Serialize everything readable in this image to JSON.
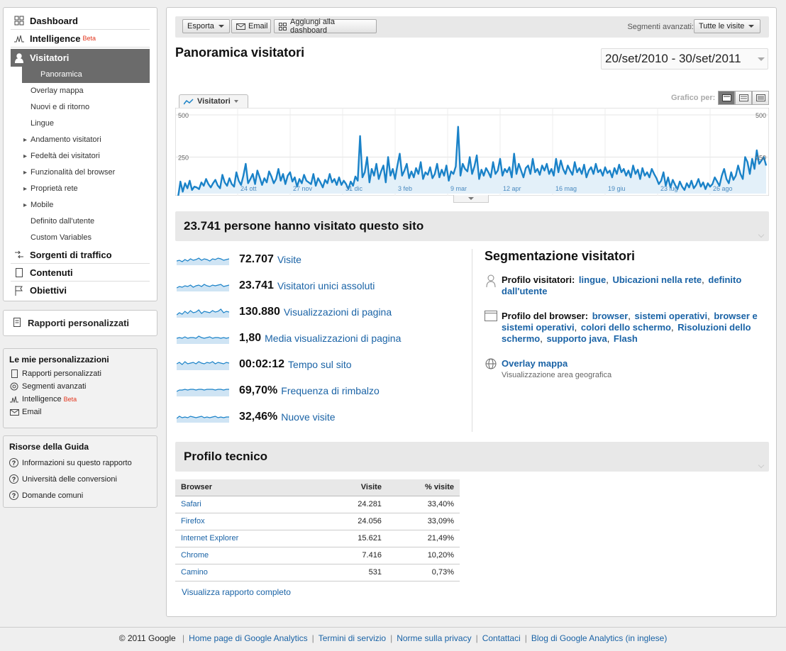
{
  "sidebar": {
    "nav": [
      {
        "label": "Dashboard",
        "icon": "dashboard-icon"
      },
      {
        "label": "Intelligence",
        "badge": "Beta",
        "icon": "intelligence-icon"
      },
      {
        "label": "Visitatori",
        "icon": "visitor-icon",
        "active": true
      },
      {
        "label": "Sorgenti di traffico",
        "icon": "traffic-sources-icon"
      },
      {
        "label": "Contenuti",
        "icon": "content-icon"
      },
      {
        "label": "Obiettivi",
        "icon": "flag-icon"
      }
    ],
    "visitor_subitems": [
      {
        "label": "Panoramica",
        "active": true,
        "arrow": false
      },
      {
        "label": "Overlay mappa",
        "arrow": false
      },
      {
        "label": "Nuovi e di ritorno",
        "arrow": false
      },
      {
        "label": "Lingue",
        "arrow": false
      },
      {
        "label": "Andamento visitatori",
        "arrow": true
      },
      {
        "label": "Fedeltà dei visitatori",
        "arrow": true
      },
      {
        "label": "Funzionalità del browser",
        "arrow": true
      },
      {
        "label": "Proprietà rete",
        "arrow": true
      },
      {
        "label": "Mobile",
        "arrow": true
      },
      {
        "label": "Definito dall'utente",
        "arrow": false
      },
      {
        "label": "Custom Variables",
        "arrow": false
      }
    ],
    "custom_reports": "Rapporti personalizzati",
    "personal": {
      "title": "Le mie personalizzazioni",
      "items": [
        {
          "label": "Rapporti personalizzati"
        },
        {
          "label": "Segmenti avanzati"
        },
        {
          "label": "Intelligence",
          "badge": "Beta"
        },
        {
          "label": "Email"
        }
      ]
    },
    "help": {
      "title": "Risorse della Guida",
      "items": [
        {
          "label": "Informazioni su questo rapporto"
        },
        {
          "label": "Università delle conversioni"
        },
        {
          "label": "Domande comuni"
        }
      ]
    }
  },
  "toolbar": {
    "export": "Esporta",
    "email": "Email",
    "add_dashboard": "Aggiungi alla dashboard",
    "segments_label": "Segmenti avanzati:",
    "segment_value": "Tutte le visite"
  },
  "page": {
    "title": "Panoramica visitatori",
    "date_range": "20/set/2010 - 30/set/2011",
    "chart_tab": "Visitatori",
    "chart_by": "Grafico per:"
  },
  "chart_data": {
    "type": "area",
    "series": [
      {
        "values": [
          12,
          105,
          45,
          95,
          65,
          110,
          55,
          75,
          70,
          60,
          100,
          80,
          120,
          90,
          70,
          95,
          115,
          82,
          65,
          145,
          100,
          80,
          125,
          90,
          75,
          160,
          110,
          85,
          140,
          210,
          95,
          120,
          150,
          90,
          170,
          130,
          85,
          125,
          100,
          165,
          135,
          95,
          120,
          180,
          110,
          150,
          90,
          140,
          160,
          105,
          130,
          75,
          120,
          95,
          145,
          110,
          100,
          90,
          150,
          80,
          125,
          100,
          70,
          115,
          95,
          150,
          100,
          120,
          85,
          130,
          85,
          110,
          90,
          60,
          105,
          80,
          135,
          110,
          375,
          130,
          160,
          250,
          100,
          180,
          140,
          210,
          120,
          165,
          200,
          100,
          250,
          140,
          180,
          120,
          200,
          270,
          140,
          170,
          210,
          125,
          165,
          130,
          185,
          150,
          220,
          120,
          160,
          145,
          190,
          125,
          150,
          210,
          130,
          175,
          140,
          200,
          110,
          165,
          150,
          195,
          430,
          140,
          210,
          180,
          165,
          250,
          150,
          195,
          260,
          120,
          175,
          140,
          185,
          160,
          130,
          220,
          150,
          170,
          240,
          140,
          180,
          160,
          190,
          130,
          270,
          150,
          210,
          170,
          130,
          185,
          200,
          150,
          240,
          160,
          180,
          145,
          200,
          170,
          210,
          150,
          180,
          140,
          240,
          160,
          230,
          180,
          150,
          200,
          170,
          145,
          220,
          160,
          185,
          150,
          205,
          130,
          170,
          190,
          150,
          210,
          160,
          175,
          140,
          190,
          155,
          170,
          130,
          185,
          150,
          205,
          160,
          180,
          140,
          170,
          130,
          200,
          150,
          175,
          120,
          185,
          140,
          160,
          130,
          180,
          150,
          125,
          90,
          110,
          160,
          80,
          130,
          70,
          115,
          85,
          60,
          105,
          75,
          55,
          95,
          70,
          110,
          65,
          85,
          120,
          75,
          100,
          60,
          95,
          75,
          90,
          130,
          105,
          80,
          140,
          180,
          120,
          95,
          160,
          115,
          140,
          200,
          150,
          120,
          250,
          220,
          150,
          240,
          180,
          290,
          210,
          230,
          250,
          200
        ]
      }
    ],
    "x_ticks": [
      "24 ott",
      "27 nov",
      "31 dic",
      "3 feb",
      "9 mar",
      "12 apr",
      "16 mag",
      "19 giu",
      "23 lug",
      "26 ago"
    ],
    "y_ticks": [
      "500",
      "250"
    ],
    "ylim": [
      0,
      500
    ],
    "color": "#1a82c8"
  },
  "summary": {
    "headline": "23.741 persone hanno visitato questo sito",
    "metrics": [
      {
        "value": "72.707",
        "label": "Visite"
      },
      {
        "value": "23.741",
        "label": "Visitatori unici assoluti"
      },
      {
        "value": "130.880",
        "label": "Visualizzazioni di pagina"
      },
      {
        "value": "1,80",
        "label": "Media visualizzazioni di pagina"
      },
      {
        "value": "00:02:12",
        "label": "Tempo sul sito"
      },
      {
        "value": "69,70%",
        "label": "Frequenza di rimbalzo"
      },
      {
        "value": "32,46%",
        "label": "Nuove visite"
      }
    ]
  },
  "segmentation": {
    "title": "Segmentazione visitatori",
    "visitor_profile_label": "Profilo visitatori:",
    "visitor_profile_links": [
      "lingue",
      "Ubicazioni nella rete",
      "definito dall'utente"
    ],
    "browser_profile_label": "Profilo del browser:",
    "browser_profile_links": [
      "browser",
      "sistemi operativi",
      "browser e sistemi operativi",
      "colori dello schermo",
      "Risoluzioni dello schermo",
      "supporto java",
      "Flash"
    ],
    "overlay_title": "Overlay mappa",
    "overlay_sub": "Visualizzazione area geografica"
  },
  "tech": {
    "title": "Profilo tecnico",
    "columns": [
      "Browser",
      "Visite",
      "% visite"
    ],
    "rows": [
      [
        "Safari",
        "24.281",
        "33,40%"
      ],
      [
        "Firefox",
        "24.056",
        "33,09%"
      ],
      [
        "Internet Explorer",
        "15.621",
        "21,49%"
      ],
      [
        "Chrome",
        "7.416",
        "10,20%"
      ],
      [
        "Camino",
        "531",
        "0,73%"
      ]
    ],
    "full_report": "Visualizza rapporto completo"
  },
  "footer": {
    "copyright": "© 2011 Google",
    "links": [
      "Home page di Google Analytics",
      "Termini di servizio",
      "Norme sulla privacy",
      "Contattaci",
      "Blog di Google Analytics (in inglese)"
    ]
  }
}
